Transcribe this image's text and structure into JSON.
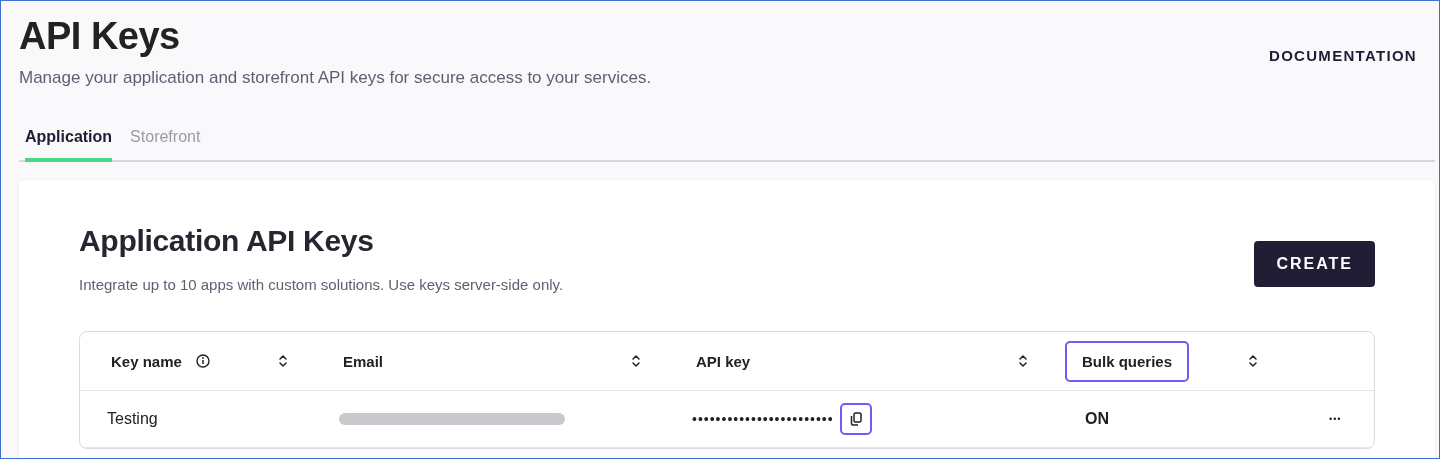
{
  "header": {
    "title": "API Keys",
    "subtitle": "Manage your application and storefront API keys for secure access to your services.",
    "link": "DOCUMENTATION"
  },
  "tabs": [
    {
      "label": "Application",
      "selected": true
    },
    {
      "label": "Storefront",
      "selected": false
    }
  ],
  "card": {
    "title": "Application API Keys",
    "subtitle": "Integrate up to 10 apps with custom solutions. Use keys server-side only.",
    "button": "CREATE"
  },
  "table": {
    "columns": [
      {
        "label": "Key name",
        "info": true,
        "highlighted": false
      },
      {
        "label": "Email",
        "info": false,
        "highlighted": false
      },
      {
        "label": "API key",
        "info": false,
        "highlighted": false
      },
      {
        "label": "Bulk queries",
        "info": false,
        "highlighted": true
      }
    ],
    "rows": [
      {
        "key_name": "Testing",
        "email_redacted": true,
        "api_key": "••••••••••••••••••••••••",
        "bulk_queries": "ON",
        "actions": "•••"
      }
    ]
  }
}
